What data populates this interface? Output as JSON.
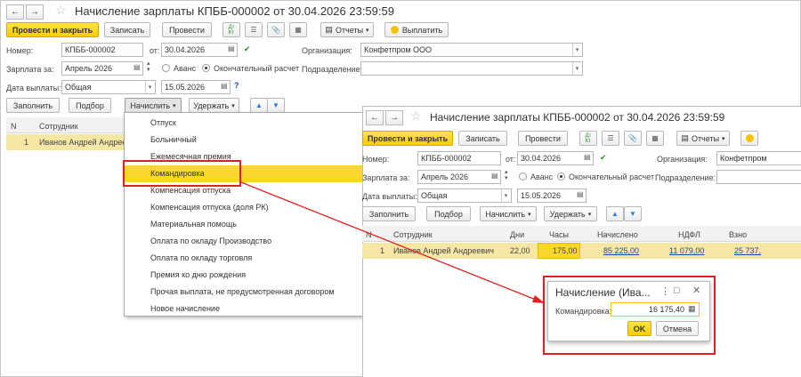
{
  "window": {
    "title": "Начисление зарплаты КПББ-000002 от 30.04.2026 23:59:59",
    "toolbar": {
      "post_close": "Провести и закрыть",
      "save": "Записать",
      "post": "Провести",
      "reports": "Отчеты",
      "pay": "Выплатить"
    },
    "fields": {
      "number_label": "Номер:",
      "number": "КПББ-000002",
      "date_from_label": "от:",
      "date": "30.04.2026",
      "org_label": "Организация:",
      "org": "Конфетпром ООО",
      "salary_for_label": "Зарплата за:",
      "salary_for": "Апрель 2026",
      "advance": "Аванс",
      "final": "Окончательный расчет",
      "dept_label": "Подразделение:",
      "pay_date_label": "Дата выплаты:",
      "pay_type": "Общая",
      "pay_date": "15.05.2026",
      "help": "?"
    },
    "actions": {
      "fill": "Заполнить",
      "select": "Подбор",
      "accrue": "Начислить",
      "withhold": "Удержать"
    },
    "table": {
      "col_n": "N",
      "col_employee": "Сотрудник",
      "row_n": "1",
      "row_employee": "Иванов Андрей Андреевич"
    }
  },
  "menu": {
    "items": [
      "Отпуск",
      "Больничный",
      "Ежемесячная премия",
      "Командировка",
      "Компенсация отпуска",
      "Компенсация отпуска (доля РК)",
      "Материальная помощь",
      "Оплата по окладу Производство",
      "Оплата по окладу торговля",
      "Премия ко дню рождения",
      "Прочая выплата, не предусмотренная договором",
      "Новое начисление"
    ],
    "selected_index": 3
  },
  "window2": {
    "title": "Начисление зарплаты КПББ-000002 от 30.04.2026 23:59:59",
    "toolbar": {
      "post_close": "Провести и закрыть",
      "save": "Записать",
      "post": "Провести",
      "reports": "Отчеты"
    },
    "fields": {
      "number_label": "Номер:",
      "number": "КПББ-000002",
      "date_from_label": "от:",
      "date": "30.04.2026",
      "org_label": "Организация:",
      "org": "Конфетпром",
      "salary_for_label": "Зарплата за:",
      "salary_for": "Апрель 2026",
      "advance": "Аванс",
      "final": "Окончательный расчет",
      "dept_label": "Подразделение:",
      "pay_date_label": "Дата выплаты:",
      "pay_type": "Общая",
      "pay_date": "15.05.2026"
    },
    "actions": {
      "fill": "Заполнить",
      "select": "Подбор",
      "accrue": "Начислить",
      "withhold": "Удержать"
    },
    "table": {
      "col_n": "N",
      "col_employee": "Сотрудник",
      "col_days": "Дни",
      "col_hours": "Часы",
      "col_accrued": "Начислено",
      "col_ndfl": "НДФЛ",
      "col_contrib": "Взно",
      "row_n": "1",
      "row_employee": "Иванов Андрей Андреевич",
      "row_days": "22,00",
      "row_hours": "175,00",
      "row_accrued": "85 225,00",
      "row_ndfl": "11 079,00",
      "row_contrib": "25 737,"
    }
  },
  "dialog": {
    "title": "Начисление (Ива...",
    "field_label": "Командировка:",
    "field_value": "16 175,40",
    "ok": "OK",
    "cancel": "Отмена"
  },
  "colors": {
    "highlight": "#fad72d",
    "annotation": "#e02020",
    "link": "#1a4b9a"
  }
}
